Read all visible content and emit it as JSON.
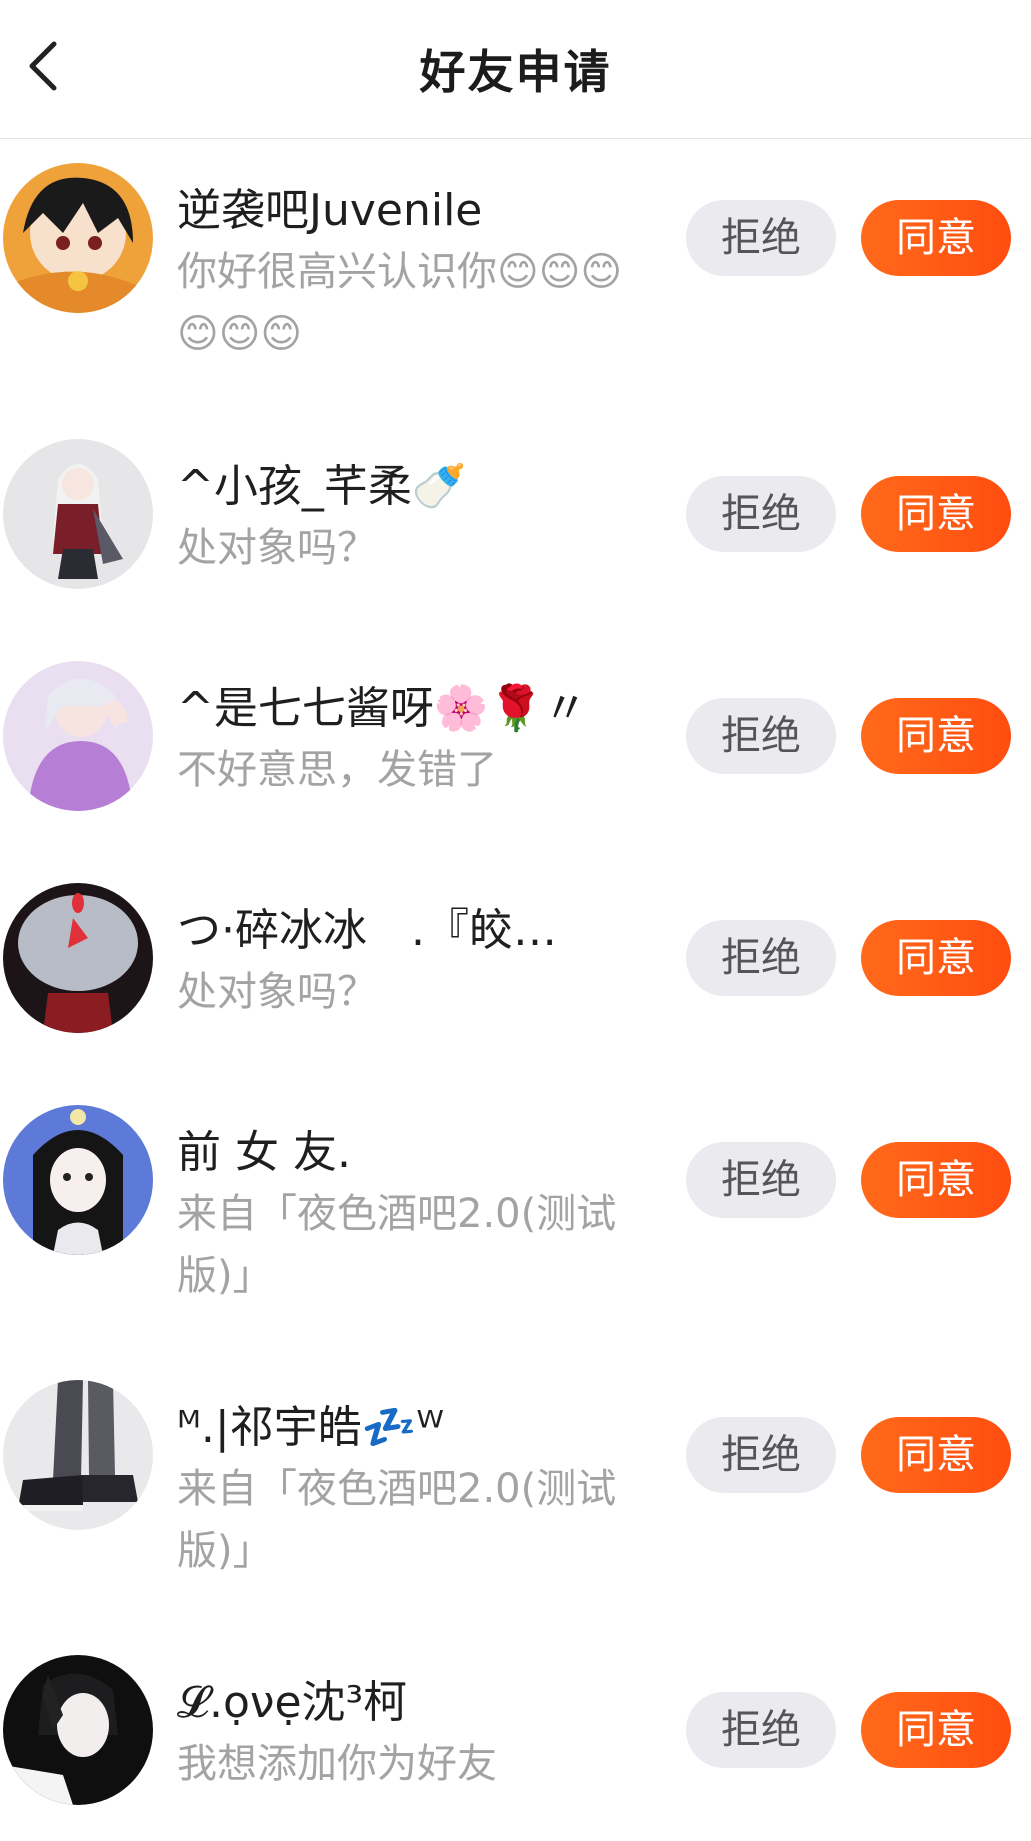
{
  "header": {
    "title": "好友申请"
  },
  "buttons": {
    "reject": "拒绝",
    "accept": "同意"
  },
  "requests": [
    {
      "name": "逆袭吧Juvenile",
      "message": "你好很高兴认识你😊😊😊😊😊😊"
    },
    {
      "name": "^小孩_芊柔🍼",
      "message": "处对象吗？"
    },
    {
      "name": "^是七七酱呀🌸🌹〃",
      "message": "不好意思，发错了"
    },
    {
      "name": "つ·碎冰冰　.『皎…",
      "message": "处对象吗？"
    },
    {
      "name": "前 女 友.",
      "message": "来自「夜色酒吧2.0(测试版)」"
    },
    {
      "name": "ᴹ.|祁宇皓💤ᵂ",
      "message": "来自「夜色酒吧2.0(测试版)」"
    },
    {
      "name": "𝓛.ọνẹ沈³柯",
      "message": "我想添加你为好友"
    }
  ],
  "icons": {
    "back": "back-arrow-icon"
  },
  "colors": {
    "accept": "#ff5a14",
    "reject_bg": "#eaeaef",
    "message": "#a3a3a3"
  }
}
